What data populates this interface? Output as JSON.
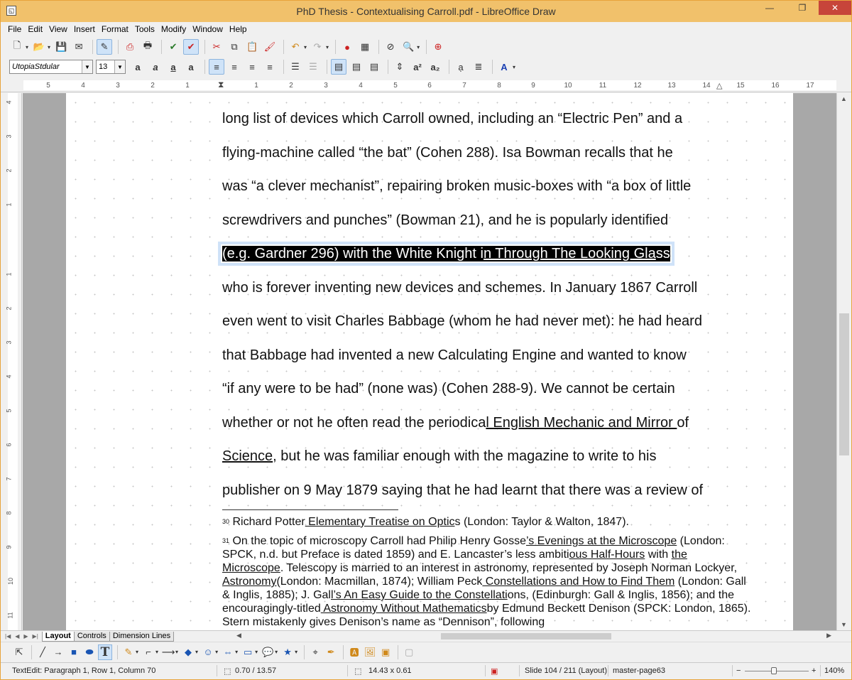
{
  "window": {
    "title": "PhD Thesis - Contextualising Carroll.pdf - LibreOffice Draw",
    "minimize": "—",
    "maximize": "❐",
    "close": "✕"
  },
  "menu": [
    "File",
    "Edit",
    "View",
    "Insert",
    "Format",
    "Tools",
    "Modify",
    "Window",
    "Help"
  ],
  "format_toolbar": {
    "font_name": "UtopiaStdular",
    "font_size": "13"
  },
  "ruler": {
    "h_ticks": [
      "5",
      "4",
      "3",
      "2",
      "1",
      "1",
      "2",
      "3",
      "4",
      "5",
      "6",
      "7",
      "8",
      "9",
      "10",
      "11",
      "12",
      "13",
      "14",
      "15",
      "16",
      "17"
    ],
    "v_ticks": [
      "4",
      "3",
      "2",
      "1",
      "1",
      "2",
      "3",
      "4",
      "5",
      "6",
      "7",
      "8",
      "9",
      "10",
      "11"
    ]
  },
  "document": {
    "lines": [
      "long list of devices which Carroll owned, including an “Electric Pen” and a",
      "flying-machine called “the bat” (Cohen 288). Isa Bowman recalls that he",
      "was “a clever mechanist”, repairing broken music-boxes with “a box of little",
      "screwdrivers and punches” (Bowman 21), and he is popularly identified"
    ],
    "selected_a": "(e.g. Gardner 296) with the White Knight i",
    "selected_b": "n Through The Looking Gla",
    "selected_c": "s",
    "selected_d": "s",
    "lines_after": [
      "who is forever inventing new devices and schemes. In January 1867 Carroll",
      "even went to visit Charles Babbage (whom he had never met): he had heard",
      "that Babbage had invented a new Calculating Engine and wanted to know",
      "“if any were to be had” (none was) (Cohen 288-9). We cannot be certain"
    ],
    "line_periodical_a": "whether or not he often read the periodica",
    "line_periodical_b": "l English Mechanic and Mirror ",
    "line_periodical_c": "of",
    "line_science_a": "Science",
    "line_science_b": ", but he was familiar enough with the magazine to write to his",
    "line_last": "publisher on 9 May 1879 saying that he had learnt that there was a review of",
    "fn30_num": "30",
    "fn30_a": " Richard Potter",
    "fn30_b": " Elementary Treatise on Optic",
    "fn30_c": "s (London: Taylor & Walton, 1847).",
    "fn31_num": "31",
    "fn31_a": " On the topic of microscopy Carroll had Philip Henry Gosse",
    "fn31_b": "’s Evenings at the Microscope",
    "fn31_c": " (London: SPCK, n.d. but Preface is dated 1859) and E. Lancaster’s less ambiti",
    "fn31_d": "ous Half-Hours",
    "fn31_e": " with ",
    "fn31_f": "the Microscope",
    "fn31_g": ". Telescopy is married to an interest in astronomy, represented by Joseph Norman Lockyer,",
    "fn31_h": " Astronomy",
    "fn31_i": "(London: Macmillan, 1874); William Peck",
    "fn31_j": " Constellations and How to Find Them",
    "fn31_k": " (London: Gall & Inglis, 1885); J. Gal",
    "fn31_l": "l’s An Easy Guide to the Constellati",
    "fn31_m": "ons, (Edinburgh: Gall & Inglis, 1856); and the encouragingly-titled",
    "fn31_n": " Astronomy Without Mathematics",
    "fn31_o": "by Edmund Beckett Denison (SPCK: London, 1865). Stern mistakenly gives Denison’s name as “Dennison”, following"
  },
  "tabs": [
    "Layout",
    "Controls",
    "Dimension Lines"
  ],
  "status": {
    "text_edit": "TextEdit: Paragraph 1, Row 1, Column 70",
    "position": "0.70 / 13.57",
    "size": "14.43 x 0.61",
    "slide": "Slide 104 / 211 (Layout)",
    "master": "master-page63",
    "zoom_minus": "−",
    "zoom_plus": "+",
    "zoom": "140%"
  }
}
